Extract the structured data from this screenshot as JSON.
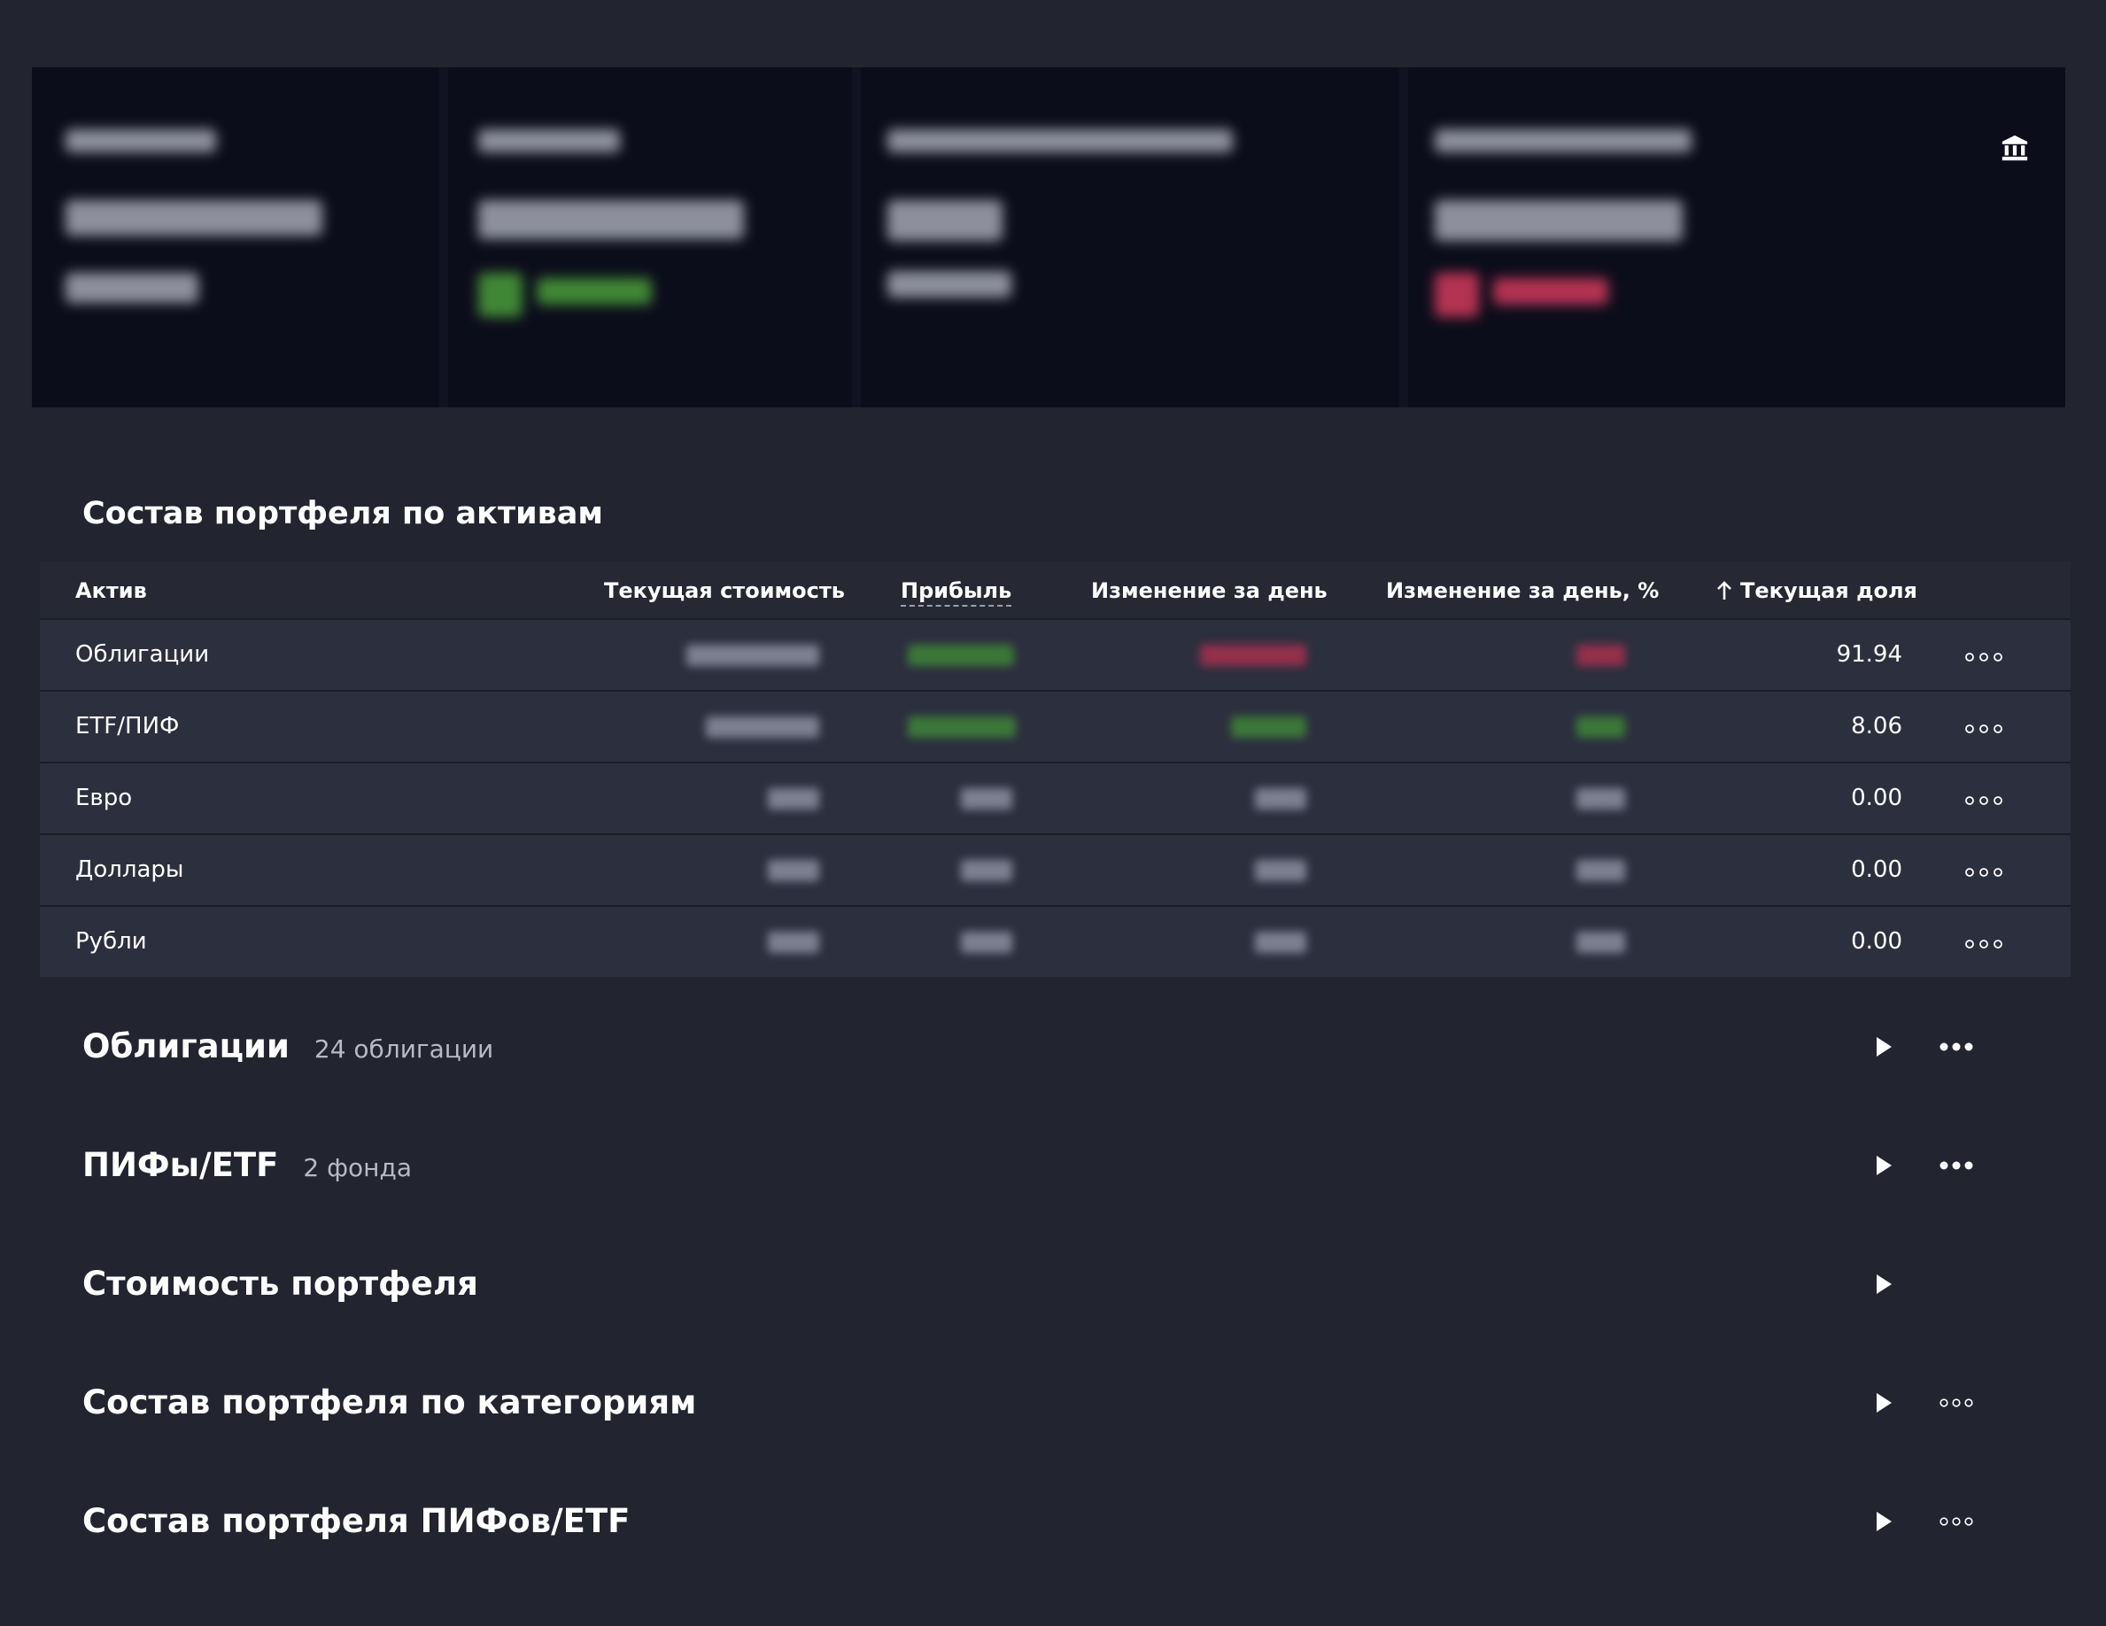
{
  "portfolio_table": {
    "title": "Состав портфеля по активам",
    "columns": {
      "asset": "Актив",
      "current_value": "Текущая стоимость",
      "profit": "Прибыль",
      "day_change": "Изменение за день",
      "day_change_pct": "Изменение за день, %",
      "current_share": "Текущая доля"
    },
    "rows": [
      {
        "name": "Облигации",
        "share": "91.94"
      },
      {
        "name": "ETF/ПИФ",
        "share": "8.06"
      },
      {
        "name": "Евро",
        "share": "0.00"
      },
      {
        "name": "Доллары",
        "share": "0.00"
      },
      {
        "name": "Рубли",
        "share": "0.00"
      }
    ]
  },
  "sections": [
    {
      "title": "Облигации",
      "count": "24 облигации"
    },
    {
      "title": "ПИФы/ETF",
      "count": "2 фонда"
    },
    {
      "title": "Стоимость портфеля",
      "count": ""
    },
    {
      "title": "Состав портфеля по категориям",
      "count": ""
    },
    {
      "title": "Состав портфеля ПИФов/ETF",
      "count": ""
    }
  ],
  "icons": {
    "summary": "bank-icon",
    "sort": "arrow-up-icon",
    "row_menu": "more-outline-icon",
    "section_toggle": "play-icon",
    "section_menu": "more-icon"
  },
  "colors": {
    "background": "#22242f",
    "summary_panel": "#0c0d1b",
    "positive": "#4ea63c",
    "negative": "#d23a5c",
    "text": "#ffffff",
    "muted": "#b7bac6"
  }
}
